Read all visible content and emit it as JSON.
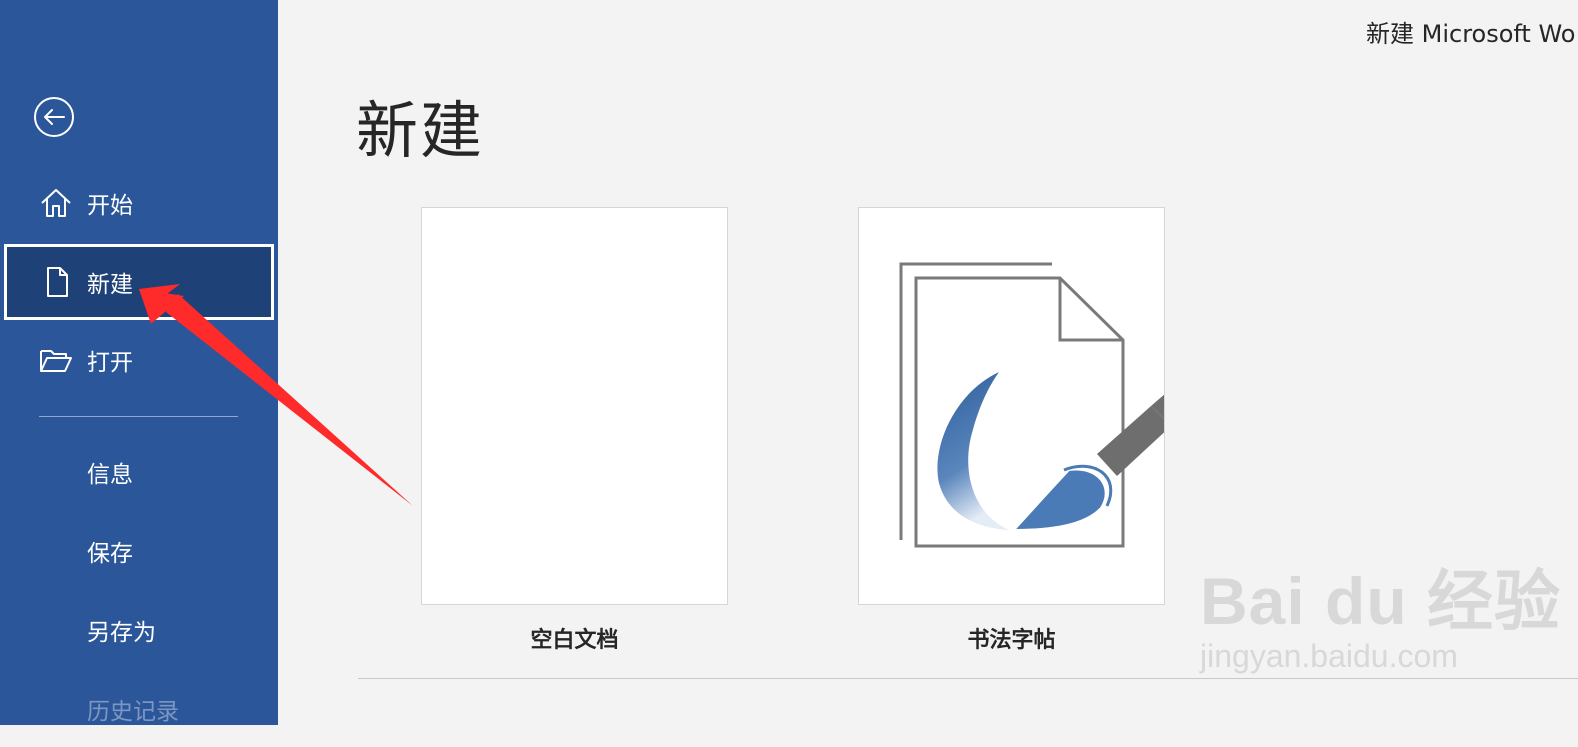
{
  "window": {
    "title": "新建 Microsoft Wo"
  },
  "sidebar": {
    "back_icon": "arrow-left-circle-icon",
    "items": [
      {
        "label": "开始",
        "icon": "home-icon"
      },
      {
        "label": "新建",
        "icon": "document-icon",
        "selected": true
      },
      {
        "label": "打开",
        "icon": "folder-open-icon"
      },
      {
        "label": "信息"
      },
      {
        "label": "保存"
      },
      {
        "label": "另存为"
      },
      {
        "label": "历史记录"
      }
    ],
    "bg_color": "#2b579a",
    "selected_color": "#1e4278"
  },
  "main": {
    "title": "新建",
    "templates": [
      {
        "label": "空白文档"
      },
      {
        "label": "书法字帖"
      }
    ]
  },
  "annotation": {
    "arrow_color": "#ff2a2a"
  },
  "watermark": {
    "logo_text": "Bai du 经验",
    "url": "jingyan.baidu.com"
  }
}
